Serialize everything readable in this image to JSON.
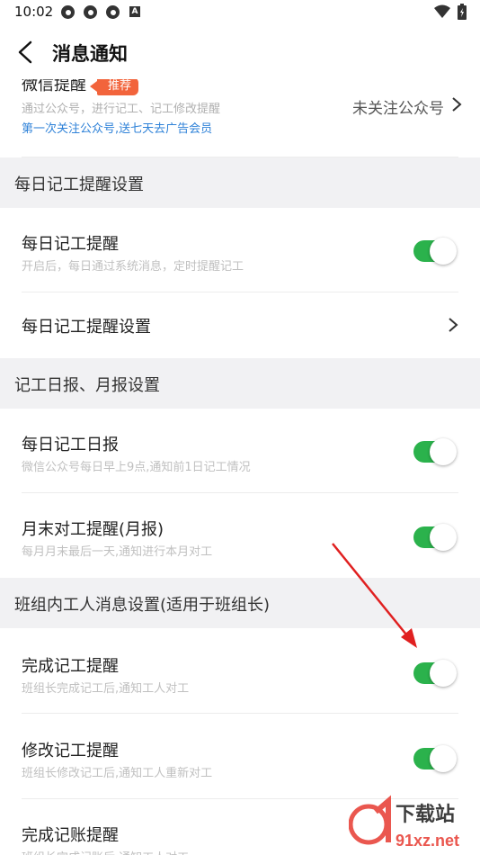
{
  "status_bar": {
    "time": "10:02",
    "notif_icons": [
      "app-icon",
      "app-icon",
      "app-icon",
      "a-icon"
    ],
    "wifi_icon": "wifi-icon",
    "battery_icon": "battery-icon"
  },
  "nav": {
    "title": "消息通知",
    "back_icon": "back-arrow-icon"
  },
  "wechat_reminder": {
    "title": "微信提醒",
    "badge": "推荐",
    "description": "通过公众号，进行记工、记工修改提醒",
    "promo_link": "第一次关注公众号,送七天去广告会员",
    "status": "未关注公众号"
  },
  "sections": [
    {
      "header": "每日记工提醒设置",
      "items": [
        {
          "title": "每日记工提醒",
          "desc": "开启后，每日通过系统消息，定时提醒记工",
          "toggle_on": true
        },
        {
          "title": "每日记工提醒设置",
          "desc": "",
          "chevron": true
        }
      ]
    },
    {
      "header": "记工日报、月报设置",
      "items": [
        {
          "title": "每日记工日报",
          "desc": "微信公众号每日早上9点,通知前1日记工情况",
          "toggle_on": true
        },
        {
          "title": "月末对工提醒(月报)",
          "desc": "每月月末最后一天,通知进行本月对工",
          "toggle_on": true
        }
      ]
    },
    {
      "header": "班组内工人消息设置(适用于班组长)",
      "items": [
        {
          "title": "完成记工提醒",
          "desc": "班组长完成记工后,通知工人对工",
          "toggle_on": true
        },
        {
          "title": "修改记工提醒",
          "desc": "班组长修改记工后,通知工人重新对工",
          "toggle_on": true
        },
        {
          "title": "完成记账提醒",
          "desc": "班组长完成记账后,通知工人对工",
          "toggle_on": true
        }
      ]
    }
  ],
  "colors": {
    "toggle_on": "#2bb24c",
    "link_blue": "#2f82d8",
    "badge_orange": "#f2643c",
    "section_bg": "#f1f1f3",
    "annotation_red": "#e02020"
  },
  "watermark": {
    "brand": "下载站",
    "domain": "91xz.net"
  }
}
